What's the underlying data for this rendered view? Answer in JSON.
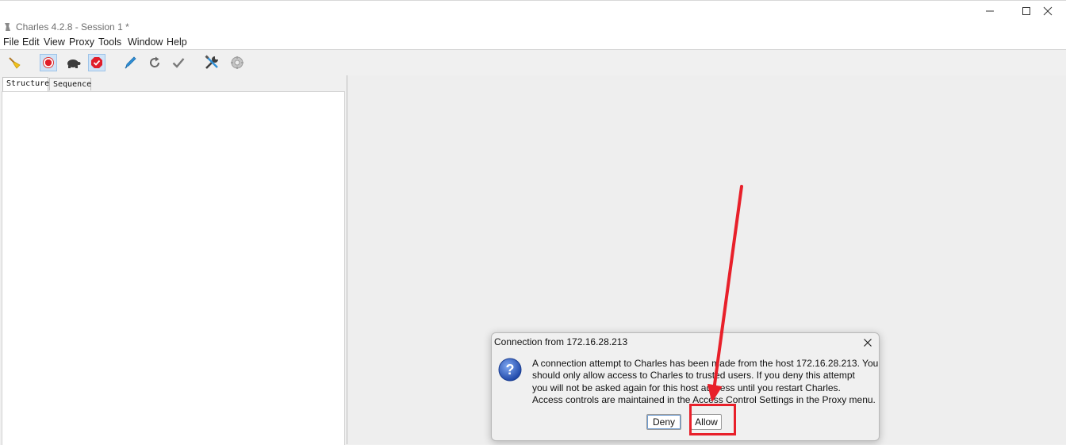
{
  "window": {
    "title": "Charles 4.2.8 - Session 1 *",
    "controls": [
      "minimize",
      "maximize",
      "close"
    ]
  },
  "menu": [
    "File",
    "Edit",
    "View",
    "Proxy",
    "Tools",
    "Window",
    "Help"
  ],
  "toolbar": {
    "buttons": [
      {
        "name": "broom-icon",
        "active": false
      },
      {
        "name": "record-icon",
        "active": true
      },
      {
        "name": "turtle-throttle-icon",
        "active": false
      },
      {
        "name": "breakpoints-icon",
        "active": true
      },
      {
        "name": "pen-compose-icon",
        "active": false
      },
      {
        "name": "repeat-icon",
        "active": false
      },
      {
        "name": "validate-check-icon",
        "active": false
      },
      {
        "name": "tools-icon",
        "active": false
      },
      {
        "name": "settings-gear-icon",
        "active": false
      }
    ]
  },
  "left_panel": {
    "tabs": [
      "Structure",
      "Sequence"
    ],
    "selected_tab": "Structure"
  },
  "dialog": {
    "title": "Connection from 172.16.28.213",
    "message_lines": [
      "A connection attempt to Charles has been made from the host 172.16.28.213. You",
      "should only allow access to Charles to trusted users. If you deny this attempt",
      "you will not be asked again for this host address until you restart Charles.",
      "Access controls are maintained in the Access Control Settings in the Proxy menu."
    ],
    "deny_label": "Deny",
    "allow_label": "Allow"
  },
  "colors": {
    "annotation": "#e8202a",
    "toolbar_active": "#cfe3f7",
    "dialog_icon": "#2a56b8"
  }
}
